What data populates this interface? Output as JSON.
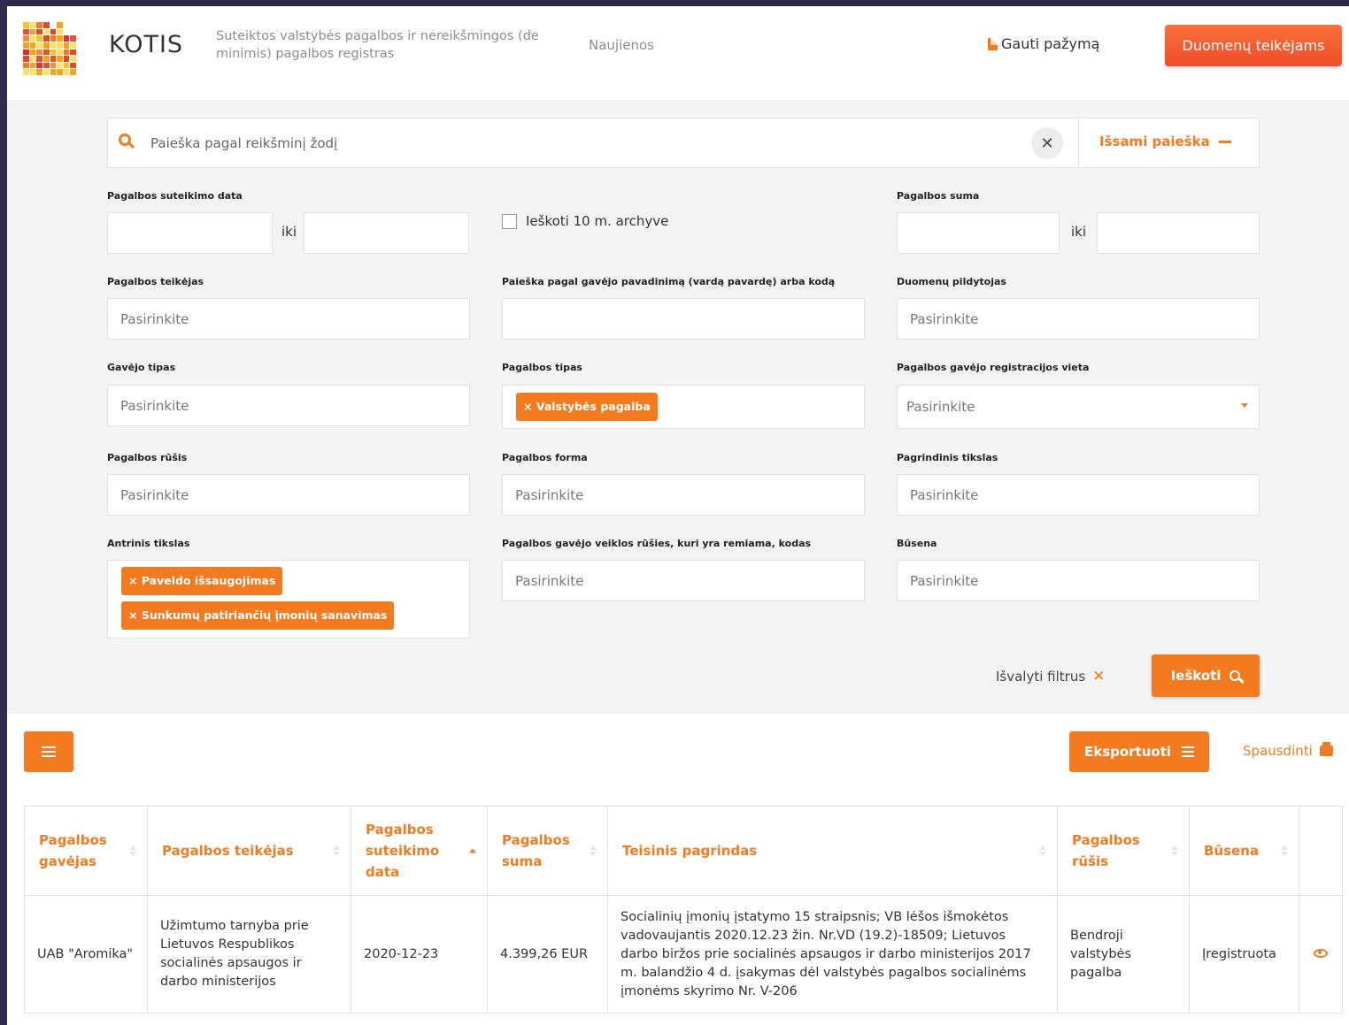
{
  "header": {
    "brand": "KOTIS",
    "tagline": "Suteiktos valstybės pagalbos ir nereikšmingos (de minimis) pagalbos registras",
    "nav_news": "Naujienos",
    "get_certificate": "Gauti pažymą",
    "data_providers_button": "Duomenų teikėjams"
  },
  "search": {
    "placeholder": "Paieška pagal reikšminį žodį",
    "advanced_label": "Išsami paieška"
  },
  "filters": {
    "date_label": "Pagalbos suteikimo data",
    "to_label": "iki",
    "archive_label": "Ieškoti 10 m. archyve",
    "sum_label": "Pagalbos suma",
    "provider_label": "Pagalbos teikėjas",
    "recipient_search_label": "Paieška pagal gavėjo pavadinimą (vardą pavardę) arba kodą",
    "data_filler_label": "Duomenų pildytojas",
    "recipient_type_label": "Gavėjo tipas",
    "aid_type_label": "Pagalbos tipas",
    "aid_type_tag": "× Valstybės pagalba",
    "registration_place_label": "Pagalbos gavėjo registracijos vieta",
    "aid_kind_label": "Pagalbos rūšis",
    "aid_form_label": "Pagalbos forma",
    "main_goal_label": "Pagrindinis tikslas",
    "secondary_goal_label": "Antrinis tikslas",
    "secondary_goal_tags": [
      "× Paveldo išsaugojimas",
      "× Sunkumų patiriančių įmonių sanavimas"
    ],
    "activity_code_label": "Pagalbos gavėjo veiklos rūšies, kuri yra remiama, kodas",
    "status_label": "Būsena",
    "select_placeholder": "Pasirinkite",
    "clear_filters": "Išvalyti filtrus",
    "search_button": "Ieškoti"
  },
  "results": {
    "export_button": "Eksportuoti",
    "print_link": "Spausdinti",
    "columns": [
      "Pagalbos gavėjas",
      "Pagalbos teikėjas",
      "Pagalbos suteikimo data",
      "Pagalbos suma",
      "Teisinis pagrindas",
      "Pagalbos rūšis",
      "Būsena"
    ],
    "rows": [
      {
        "recipient": "UAB \"Aromika\"",
        "provider": "Užimtumo tarnyba prie Lietuvos Respublikos socialinės apsaugos ir darbo ministerijos",
        "date": "2020-12-23",
        "amount": "4.399,26 EUR",
        "legal_basis": "Socialinių įmonių įstatymo 15 straipsnis; VB lėšos išmokėtos vadovaujantis 2020.12.23 žin. Nr.VD (19.2)-18509; Lietuvos darbo biržos prie socialinės apsaugos ir darbo ministerijos 2017 m. balandžio 4 d. įsakymas dėl valstybės pagalbos socialinėms įmonėms skyrimo Nr. V-206",
        "kind": "Bendroji valstybės pagalba",
        "status": "Įregistruota"
      }
    ]
  },
  "colors": {
    "accent": "#f47a20",
    "provider_button": "#f04d2a",
    "status_registered": "#3aa842",
    "frame": "#2d2a4a"
  }
}
